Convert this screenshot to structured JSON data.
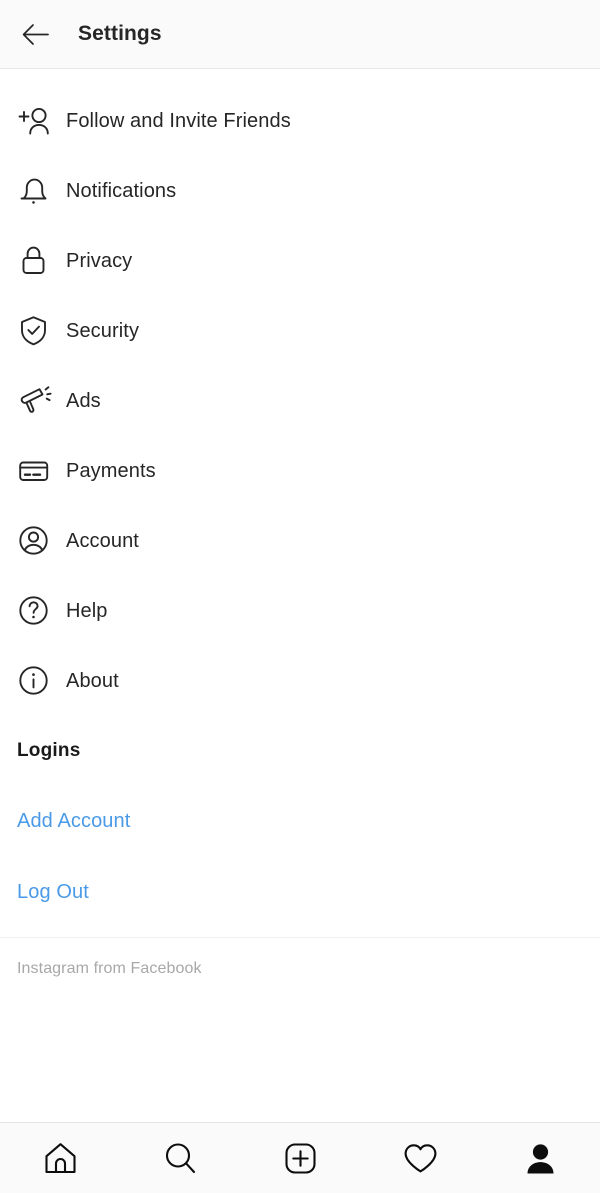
{
  "header": {
    "title": "Settings",
    "back_icon": "arrow-left-icon"
  },
  "menu": {
    "items": [
      {
        "label": "Follow and Invite Friends",
        "icon": "person-add-icon"
      },
      {
        "label": "Notifications",
        "icon": "bell-icon"
      },
      {
        "label": "Privacy",
        "icon": "lock-icon"
      },
      {
        "label": "Security",
        "icon": "shield-check-icon"
      },
      {
        "label": "Ads",
        "icon": "megaphone-icon"
      },
      {
        "label": "Payments",
        "icon": "credit-card-icon"
      },
      {
        "label": "Account",
        "icon": "person-circle-icon"
      },
      {
        "label": "Help",
        "icon": "question-circle-icon"
      },
      {
        "label": "About",
        "icon": "info-circle-icon"
      }
    ]
  },
  "logins": {
    "heading": "Logins",
    "add_account_label": "Add Account",
    "log_out_label": "Log Out"
  },
  "footer": {
    "note": "Instagram from Facebook"
  },
  "bottom_nav": {
    "items": [
      {
        "name": "home",
        "icon": "home-icon",
        "active": false
      },
      {
        "name": "search",
        "icon": "search-icon",
        "active": false
      },
      {
        "name": "create",
        "icon": "plus-square-icon",
        "active": false
      },
      {
        "name": "activity",
        "icon": "heart-icon",
        "active": false
      },
      {
        "name": "profile",
        "icon": "person-filled-icon",
        "active": true
      }
    ]
  },
  "colors": {
    "link_blue": "#4a9ae8",
    "text_primary": "#262626",
    "text_muted": "#a8a8a8",
    "header_bg": "#fafafa"
  }
}
